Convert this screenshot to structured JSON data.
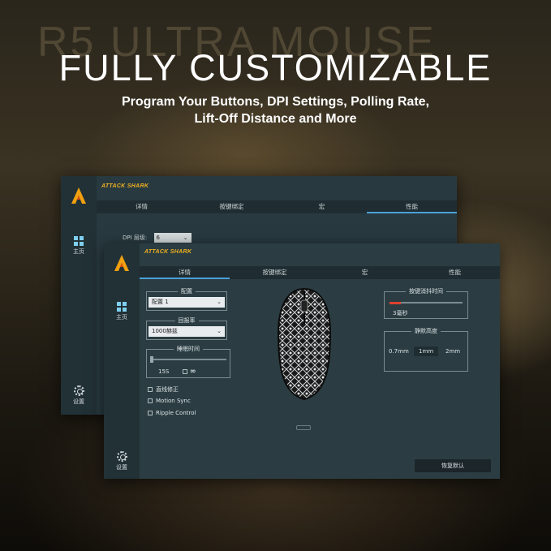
{
  "promo": {
    "watermark": "R5 ULTRA MOUSE",
    "headline": "FULLY CUSTOMIZABLE",
    "subline_1": "Program Your Buttons, DPI Settings, Polling Rate,",
    "subline_2": "Lift-Off Distance and More"
  },
  "back_window": {
    "brand": "ATTACK SHARK",
    "tabs": [
      "详情",
      "按键绑定",
      "宏",
      "性能"
    ],
    "active_tab": 3,
    "nav": {
      "home": "主页",
      "settings": "设置"
    },
    "dpi_label": "DPI 层级:",
    "dpi_value": "6"
  },
  "front_window": {
    "brand": "ATTACK SHARK",
    "tabs": [
      "详情",
      "按键绑定",
      "宏",
      "性能"
    ],
    "active_tab": 0,
    "nav": {
      "home": "主页",
      "settings": "设置"
    },
    "config": {
      "title": "配置",
      "value": "配置 1"
    },
    "polling": {
      "title": "回报率",
      "value": "1000赫兹"
    },
    "sleep": {
      "title": "睡眠时间",
      "value": "15S",
      "infinite_symbol": "∞",
      "level": 0.0
    },
    "checkboxes": [
      {
        "label": "直线修正",
        "checked": false
      },
      {
        "label": "Motion Sync",
        "checked": false
      },
      {
        "label": "Ripple Control",
        "checked": false
      }
    ],
    "debounce": {
      "title": "按键消抖时间",
      "value": "3毫秒",
      "level": 0.15
    },
    "lod": {
      "title": "静默高度",
      "options": [
        "0.7mm",
        "1mm",
        "2mm"
      ],
      "selected": "1mm"
    },
    "restore_button": "恢复默认"
  },
  "colors": {
    "accent": "#4aa0d8",
    "brand": "#f0b020",
    "slider_red": "#e04030"
  }
}
